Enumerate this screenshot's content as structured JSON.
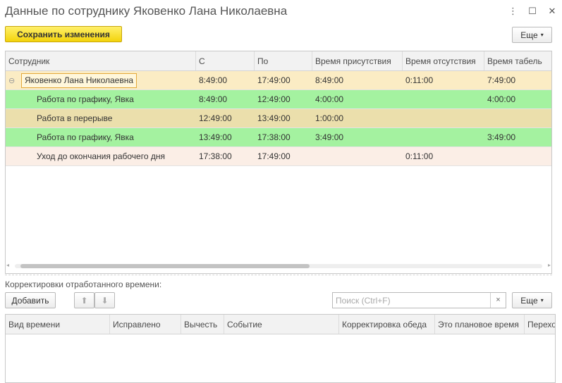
{
  "window": {
    "title": "Данные по сотруднику Яковенко Лана Николаевна",
    "more_icon": "⋮",
    "maximize_icon": "☐",
    "close_icon": "✕"
  },
  "toolbar": {
    "save_label": "Сохранить изменения",
    "more_label": "Еще"
  },
  "main_table": {
    "columns": [
      "Сотрудник",
      "С",
      "По",
      "Время присутствия",
      "Время отсутствия",
      "Время табель"
    ],
    "rows": [
      {
        "name": "Яковенко Лана Николаевна",
        "from": "8:49:00",
        "to": "17:49:00",
        "presence": "8:49:00",
        "absence": "0:11:00",
        "timesheet": "7:49:00"
      },
      {
        "name": "Работа по графику, Явка",
        "from": "8:49:00",
        "to": "12:49:00",
        "presence": "4:00:00",
        "absence": "",
        "timesheet": "4:00:00"
      },
      {
        "name": "Работа в перерыве",
        "from": "12:49:00",
        "to": "13:49:00",
        "presence": "1:00:00",
        "absence": "",
        "timesheet": ""
      },
      {
        "name": "Работа по графику, Явка",
        "from": "13:49:00",
        "to": "17:38:00",
        "presence": "3:49:00",
        "absence": "",
        "timesheet": "3:49:00"
      },
      {
        "name": "Уход до окончания рабочего дня",
        "from": "17:38:00",
        "to": "17:49:00",
        "presence": "",
        "absence": "0:11:00",
        "timesheet": ""
      }
    ]
  },
  "corrections": {
    "section_label": "Корректировки отработанного времени:",
    "add_label": "Добавить",
    "search_placeholder": "Поиск (Ctrl+F)",
    "clear_icon": "×",
    "more_label": "Еще",
    "columns": [
      "Вид времени",
      "Исправлено",
      "Вычесть",
      "Событие",
      "Корректировка обеда",
      "Это плановое время",
      "Перехо"
    ]
  },
  "icons": {
    "collapse": "⊖",
    "caret_down": "▾",
    "arrow_up": "⬆",
    "arrow_down": "⬇",
    "scroll_left": "◂",
    "scroll_right": "▸"
  },
  "colors": {
    "primary_button": "#f3d30b",
    "row_parent": "#fbecc4",
    "row_work": "#a4f2a0",
    "row_break": "#ebdfac",
    "row_leave": "#fbeee6"
  }
}
